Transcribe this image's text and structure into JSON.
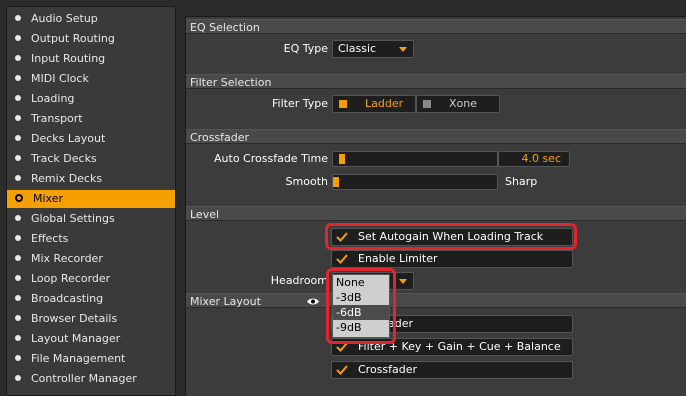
{
  "sidebar": {
    "items": [
      {
        "label": "Audio Setup",
        "active": false
      },
      {
        "label": "Output Routing",
        "active": false
      },
      {
        "label": "Input Routing",
        "active": false
      },
      {
        "label": "MIDI Clock",
        "active": false
      },
      {
        "label": "Loading",
        "active": false
      },
      {
        "label": "Transport",
        "active": false
      },
      {
        "label": "Decks Layout",
        "active": false
      },
      {
        "label": "Track Decks",
        "active": false
      },
      {
        "label": "Remix Decks",
        "active": false
      },
      {
        "label": "Mixer",
        "active": true
      },
      {
        "label": "Global Settings",
        "active": false
      },
      {
        "label": "Effects",
        "active": false
      },
      {
        "label": "Mix Recorder",
        "active": false
      },
      {
        "label": "Loop Recorder",
        "active": false
      },
      {
        "label": "Broadcasting",
        "active": false
      },
      {
        "label": "Browser Details",
        "active": false
      },
      {
        "label": "Layout Manager",
        "active": false
      },
      {
        "label": "File Management",
        "active": false
      },
      {
        "label": "Controller Manager",
        "active": false
      }
    ]
  },
  "eq_selection": {
    "header": "EQ Selection",
    "eq_type_label": "EQ Type",
    "eq_type_value": "Classic"
  },
  "filter_selection": {
    "header": "Filter Selection",
    "filter_type_label": "Filter Type",
    "options": [
      "Ladder",
      "Xone"
    ],
    "selected": "Ladder"
  },
  "crossfader": {
    "header": "Crossfader",
    "auto_crossfade_label": "Auto Crossfade Time",
    "auto_crossfade_value": "4.0 sec",
    "smooth_label": "Smooth",
    "sharp_label": "Sharp"
  },
  "level": {
    "header": "Level",
    "autogain_label": "Set Autogain When Loading Track",
    "autogain_checked": true,
    "limiter_label": "Enable Limiter",
    "limiter_checked": true,
    "headroom_label": "Headroom",
    "headroom_options": [
      "None",
      "-3dB",
      "-6dB",
      "-9dB"
    ],
    "headroom_selected": "-6dB"
  },
  "mixer_layout": {
    "header": "Mixer Layout",
    "row1_label": "ader",
    "row2_label": "Filter + Key + Gain + Cue + Balance",
    "row3_label": "Crossfader"
  },
  "colors": {
    "accent": "#f5a000",
    "highlight": "#e0262e"
  }
}
